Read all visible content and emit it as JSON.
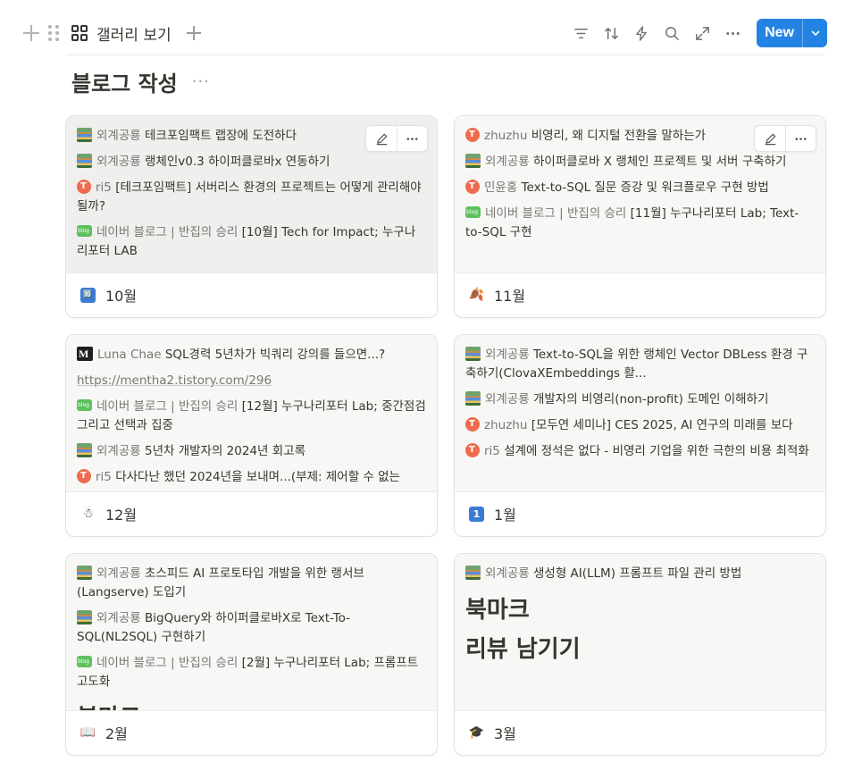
{
  "toolbar": {
    "view_label": "갤러리 보기",
    "new_label": "New",
    "icons": [
      "filter-icon",
      "sort-icon",
      "lightning-icon",
      "search-icon",
      "expand-icon",
      "more-icon"
    ]
  },
  "page": {
    "title": "블로그 작성",
    "title_more": "···"
  },
  "cards": [
    {
      "name": "10월",
      "footer_emoji": "🔟",
      "items": [
        {
          "icon": "book",
          "source": "외계공룡",
          "title": "테크포임팩트 랩장에 도전하다"
        },
        {
          "icon": "book",
          "source": "외계공룡",
          "title": "랭체인v0.3 하이퍼클로바x 연동하기"
        },
        {
          "icon": "tistory",
          "source": "ri5",
          "title": "[테크포임팩트] 서버리스 환경의 프로젝트는 어떻게 관리해야 될까?"
        },
        {
          "icon": "naver",
          "source": "네이버 블로그 | 반집의 승리",
          "title": "[10월] Tech for Impact; 누구나리포터 LAB"
        }
      ]
    },
    {
      "name": "11월",
      "footer_emoji": "🍂",
      "items": [
        {
          "icon": "tistory",
          "source": "zhuzhu",
          "title": "비영리, 왜 디지털 전환을 말하는가"
        },
        {
          "icon": "book",
          "source": "외계공룡",
          "title": "하이퍼클로바 X 랭체인 프로젝트 및 서버 구축하기"
        },
        {
          "icon": "tistory",
          "source": "민윤홍",
          "title": "Text-to-SQL 질문 증강 및 워크플로우 구현 방법"
        },
        {
          "icon": "naver",
          "source": "네이버 블로그 | 반집의 승리",
          "title": "[11월] 누구나리포터 Lab; Text-to-SQL 구현"
        }
      ]
    },
    {
      "name": "12월",
      "footer_emoji": "☃",
      "items": [
        {
          "icon": "mc",
          "source": "Luna Chae",
          "title": "SQL경력 5년차가 빅쿼리 강의를 들으면...?"
        },
        {
          "icon": "url",
          "source": "https://mentha2.tistory.com/296",
          "title": ""
        },
        {
          "icon": "naver",
          "source": "네이버 블로그 | 반집의 승리",
          "title": "[12월] 누구나리포터 Lab; 중간점검 그리고 선택과 집중"
        },
        {
          "icon": "book",
          "source": "외계공룡",
          "title": "5년차 개발자의 2024년 회고록"
        },
        {
          "icon": "tistory",
          "source": "ri5",
          "title": "다사다난 했던 2024년을 보내며...(부제: 제어할 수 없는"
        }
      ]
    },
    {
      "name": "1월",
      "footer_emoji": "1",
      "items": [
        {
          "icon": "book",
          "source": "외계공룡",
          "title": "Text-to-SQL을 위한 랭체인 Vector DBLess 환경 구축하기(ClovaXEmbeddings 활..."
        },
        {
          "icon": "book",
          "source": "외계공룡",
          "title": "개발자의 비영리(non-profit) 도메인 이해하기"
        },
        {
          "icon": "tistory",
          "source": "zhuzhu",
          "title": "[모두연 세미나] CES 2025, AI 연구의 미래를 보다"
        },
        {
          "icon": "tistory",
          "source": "ri5",
          "title": "설계에 정석은 없다 - 비영리 기업을 위한 극한의 비용 최적화"
        }
      ]
    },
    {
      "name": "2월",
      "footer_emoji": "📖",
      "items": [
        {
          "icon": "book",
          "source": "외계공룡",
          "title": "초스피드 AI 프로토타입 개발을 위한 랭서브(Langserve) 도입기"
        },
        {
          "icon": "book",
          "source": "외계공룡",
          "title": "BigQuery와 하이퍼클로바X로 Text-To-SQL(NL2SQL) 구현하기"
        },
        {
          "icon": "naver",
          "source": "네이버 블로그 | 반집의 승리",
          "title": "[2월] 누구나리포터 Lab; 프롬프트 고도화"
        }
      ],
      "big_text": [
        "북마크"
      ]
    },
    {
      "name": "3월",
      "footer_emoji": "🎓",
      "items": [
        {
          "icon": "book",
          "source": "외계공룡",
          "title": "생성형 AI(LLM) 프롬프트 파일 관리 방법"
        }
      ],
      "big_text": [
        "북마크",
        "리뷰 남기기"
      ]
    }
  ]
}
